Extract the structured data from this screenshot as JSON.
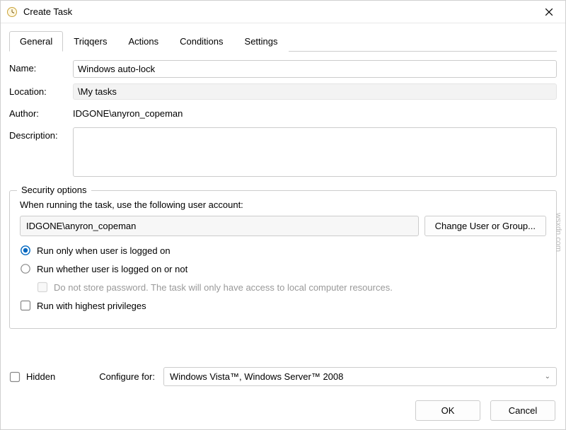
{
  "window": {
    "title": "Create Task"
  },
  "tabs": [
    "General",
    "Triqqers",
    "Actions",
    "Conditions",
    "Settings"
  ],
  "active_tab": 0,
  "form": {
    "name_label": "Name:",
    "name_value": "Windows auto-lock",
    "location_label": "Location:",
    "location_value": "\\My tasks",
    "author_label": "Author:",
    "author_value": "IDGONE\\anyron_copeman",
    "description_label": "Description:",
    "description_value": ""
  },
  "security": {
    "legend": "Security options",
    "when_running_label": "When running the task, use the following user account:",
    "account": "IDGONE\\anyron_copeman",
    "change_user_btn": "Change User or Group...",
    "radio_logged_on": "Run only when user is logged on",
    "radio_logged_on_or_not": "Run whether user is logged on or not",
    "radio_selected": "logged_on",
    "no_store_pw_label": "Do not store password.  The task will only have access to local computer resources.",
    "highest_priv_label": "Run with highest privileges"
  },
  "bottom": {
    "hidden_label": "Hidden",
    "configure_for_label": "Configure for:",
    "configure_for_value": "Windows Vista™, Windows Server™ 2008"
  },
  "footer": {
    "ok": "OK",
    "cancel": "Cancel"
  },
  "watermark": "wsxdn.com"
}
